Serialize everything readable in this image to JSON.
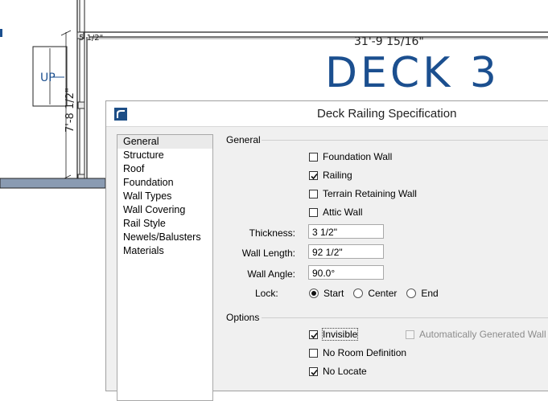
{
  "drawing": {
    "dimension_top": "31'-9 15/16\"",
    "dimension_small": "5 1/2\"",
    "dimension_vertical": "7'-8 1/2\"",
    "deck_label": "DECK 3",
    "stair_label": "UP"
  },
  "dialog": {
    "title": "Deck Railing Specification",
    "sidebar": [
      {
        "label": "General",
        "selected": true
      },
      {
        "label": "Structure"
      },
      {
        "label": "Roof"
      },
      {
        "label": "Foundation"
      },
      {
        "label": "Wall Types"
      },
      {
        "label": "Wall Covering"
      },
      {
        "label": "Rail Style"
      },
      {
        "label": "Newels/Balusters"
      },
      {
        "label": "Materials"
      }
    ],
    "general": {
      "heading": "General",
      "checkboxes": [
        {
          "label": "Foundation Wall",
          "checked": false
        },
        {
          "label": "Railing",
          "checked": true
        },
        {
          "label": "Terrain Retaining Wall",
          "checked": false
        },
        {
          "label": "Attic Wall",
          "checked": false
        }
      ],
      "thickness_label": "Thickness:",
      "thickness_value": "3 1/2\"",
      "wall_length_label": "Wall Length:",
      "wall_length_value": "92 1/2\"",
      "wall_angle_label": "Wall Angle:",
      "wall_angle_value": "90.0°",
      "lock_label": "Lock:",
      "lock_options": [
        "Start",
        "Center",
        "End"
      ],
      "lock_selected": "Start"
    },
    "options": {
      "heading": "Options",
      "invisible_label": "Invisible",
      "invisible_checked": true,
      "auto_generated_label": "Automatically Generated Wall",
      "auto_generated_checked": false,
      "no_room_label": "No Room Definition",
      "no_room_checked": false,
      "no_locate_label": "No Locate",
      "no_locate_checked": true
    }
  }
}
